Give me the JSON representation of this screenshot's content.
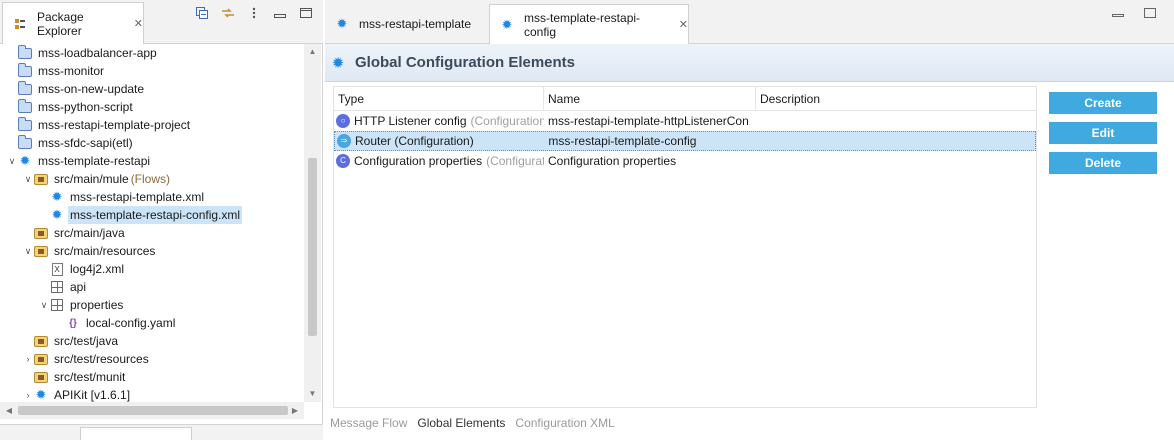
{
  "explorer": {
    "tab_label": "Package Explorer",
    "tree": [
      {
        "label": "mss-loadbalancer-app",
        "icon": "folder-icon",
        "indent": 0
      },
      {
        "label": "mss-monitor",
        "icon": "folder-icon",
        "indent": 0
      },
      {
        "label": "mss-on-new-update",
        "icon": "folder-icon",
        "indent": 0
      },
      {
        "label": "mss-python-script",
        "icon": "folder-icon",
        "indent": 0
      },
      {
        "label": "mss-restapi-template-project",
        "icon": "folder-icon",
        "indent": 0
      },
      {
        "label": "mss-sfdc-sapi(etl)",
        "icon": "folder-icon",
        "indent": 0
      },
      {
        "label": "mss-template-restapi",
        "icon": "mule-project-icon",
        "indent": 0,
        "expanded": true
      },
      {
        "label": "src/main/mule",
        "decoration": "(Flows)",
        "icon": "package-folder-icon",
        "indent": 1,
        "expanded": true
      },
      {
        "label": "mss-restapi-template.xml",
        "icon": "mule-config-icon",
        "indent": 2
      },
      {
        "label": "mss-template-restapi-config.xml",
        "icon": "mule-config-icon",
        "indent": 2,
        "selected": true
      },
      {
        "label": "src/main/java",
        "icon": "package-folder-icon",
        "indent": 1
      },
      {
        "label": "src/main/resources",
        "icon": "package-folder-icon",
        "indent": 1,
        "expanded": true
      },
      {
        "label": "log4j2.xml",
        "icon": "xml-file-icon",
        "indent": 2
      },
      {
        "label": "api",
        "icon": "package-icon",
        "indent": 2
      },
      {
        "label": "properties",
        "icon": "package-icon",
        "indent": 2,
        "expanded": true
      },
      {
        "label": "local-config.yaml",
        "icon": "yaml-file-icon",
        "indent": 3
      },
      {
        "label": "src/test/java",
        "icon": "package-folder-icon",
        "indent": 1
      },
      {
        "label": "src/test/resources",
        "icon": "package-folder-icon",
        "indent": 1,
        "collapsed": true
      },
      {
        "label": "src/test/munit",
        "icon": "package-folder-icon",
        "indent": 1
      },
      {
        "label": "APIKit [v1.6.1]",
        "icon": "library-icon",
        "indent": 1,
        "collapsed": true
      }
    ]
  },
  "editor": {
    "tabs": [
      {
        "label": "mss-restapi-template",
        "active": false
      },
      {
        "label": "mss-template-restapi-config",
        "active": true
      }
    ],
    "section_title": "Global Configuration Elements",
    "columns": [
      "Type",
      "Name",
      "Description"
    ],
    "rows": [
      {
        "type": "HTTP Listener config",
        "type_hint": "(Configuration)",
        "name": "mss-restapi-template-httpListenerCon",
        "description": "",
        "selected": false
      },
      {
        "type": "Router (Configuration)",
        "type_hint": "",
        "name": "mss-restapi-template-config",
        "description": "",
        "selected": true
      },
      {
        "type": "Configuration properties",
        "type_hint": "(Configuration)",
        "name": "Configuration properties",
        "description": "",
        "selected": false
      }
    ],
    "buttons": {
      "create": "Create",
      "edit": "Edit",
      "delete": "Delete"
    },
    "bottom_tabs": [
      "Message Flow",
      "Global Elements",
      "Configuration XML"
    ],
    "active_bottom_tab": "Global Elements"
  },
  "colors": {
    "accent_button": "#3fa9e0",
    "selection": "#cce4f7",
    "header_title": "#3b4a5c"
  }
}
